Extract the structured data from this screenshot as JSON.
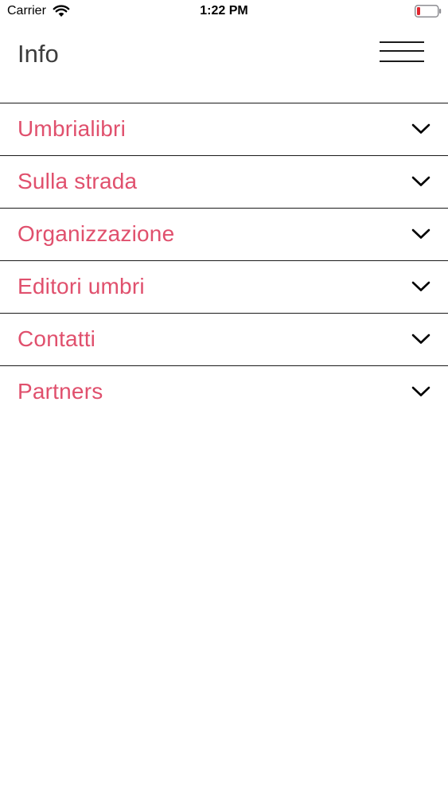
{
  "status_bar": {
    "carrier": "Carrier",
    "time": "1:22 PM",
    "battery_color": "#e0272f"
  },
  "header": {
    "title": "Info",
    "menu_icon": "hamburger-icon"
  },
  "accordion": {
    "accent_color": "#e0506d",
    "items": [
      {
        "label": "Umbrialibri",
        "icon": "chevron-down-icon"
      },
      {
        "label": "Sulla strada",
        "icon": "chevron-down-icon"
      },
      {
        "label": "Organizzazione",
        "icon": "chevron-down-icon"
      },
      {
        "label": "Editori umbri",
        "icon": "chevron-down-icon"
      },
      {
        "label": "Contatti",
        "icon": "chevron-down-icon"
      },
      {
        "label": "Partners",
        "icon": "chevron-down-icon"
      }
    ]
  }
}
